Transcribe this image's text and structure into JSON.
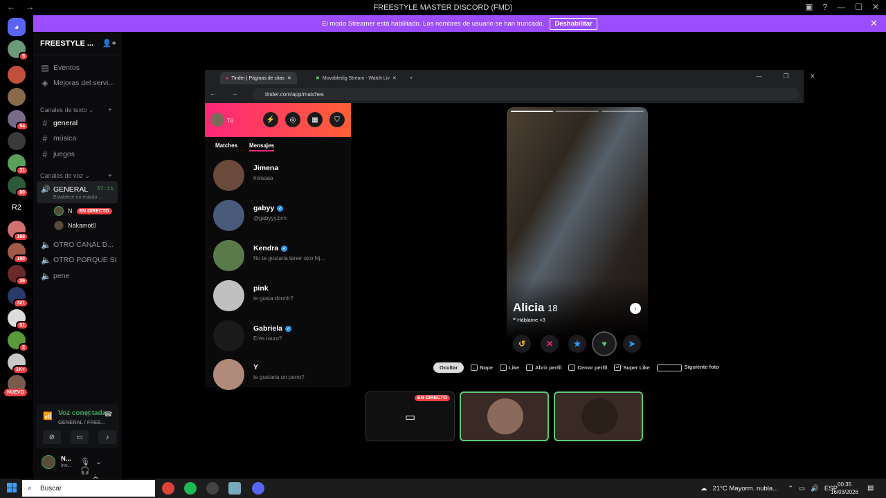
{
  "window": {
    "title": "FREESTYLE MASTER DISCORD (FMD)"
  },
  "banner": {
    "text": "El modo Streamer está habilitado. Los nombres de usuario se han truncado.",
    "button": "Deshabilitar"
  },
  "guilds": {
    "badges": [
      "5",
      "",
      "",
      "54",
      "",
      "31",
      "80",
      "",
      "168",
      "190",
      "26",
      "321",
      "51",
      "2",
      "1K+",
      ""
    ],
    "r2_label": "R2",
    "nuevo": "NUEVO"
  },
  "server": {
    "name": "FREESTYLE ...",
    "events": "Eventos",
    "boosts": "Mejoras del servi...",
    "text_category": "Canales de texto",
    "text_channels": [
      "general",
      "música",
      "juegos"
    ],
    "voice_category": "Canales de voz",
    "active_voice": {
      "name": "GENERAL",
      "timer": "57:11",
      "status": "Establece un estado ..."
    },
    "voice_users": [
      {
        "name": "N",
        "live": "EN DIRECTO"
      },
      {
        "name": "Nakamot0"
      }
    ],
    "voice_channels": [
      "OTRO CANAL D...",
      "OTRO PORQUE SI",
      "pene"
    ]
  },
  "voice_panel": {
    "connected": "Voz conectada",
    "location": "GENERAL / FREE..."
  },
  "user_panel": {
    "name": "N...",
    "status": "Inv..."
  },
  "browser": {
    "tabs": [
      "Tinder | Páginas de citas",
      "Movabledig Stream - Watch Liv"
    ],
    "url": "tinder.com/app/matches"
  },
  "tinder": {
    "me": "Tú",
    "tabs": [
      "Matches",
      "Mensajes"
    ],
    "messages": [
      {
        "name": "Jimena",
        "preview": "holaaaa",
        "verified": false
      },
      {
        "name": "gabyy",
        "preview": "@gabyyy.bcn",
        "verified": true
      },
      {
        "name": "Kendra",
        "preview": "No te gustaria tener otro hij...",
        "verified": true
      },
      {
        "name": "pink",
        "preview": "te gusta dormir?",
        "verified": false
      },
      {
        "name": "Gabriela",
        "preview": "Eres tauro?",
        "verified": true
      },
      {
        "name": "Y",
        "preview": "te gustaria un perro?",
        "verified": false
      }
    ],
    "profile": {
      "name": "Alicia",
      "age": "18",
      "bio": "Háblame <3"
    },
    "hints": {
      "hide": "Ocultar",
      "nope": "Nope",
      "like": "Like",
      "open": "Abrir perfil",
      "close": "Cerrar perfil",
      "super": "Super Like",
      "next": "Siguiente foto"
    }
  },
  "stream": {
    "live": "EN DIRECTO"
  },
  "taskbar": {
    "search": "Buscar",
    "weather": "21°C  Mayorm. nubla...",
    "lang": "ESP",
    "time": "00:35",
    "date": "16/03/2026"
  },
  "colors": {
    "streamer_banner": "#9b4dff",
    "tinder_gradient_start": "#fd267a",
    "tinder_gradient_end": "#ff6036",
    "voice_green": "#3ba55d",
    "live_red": "#f23f43"
  }
}
